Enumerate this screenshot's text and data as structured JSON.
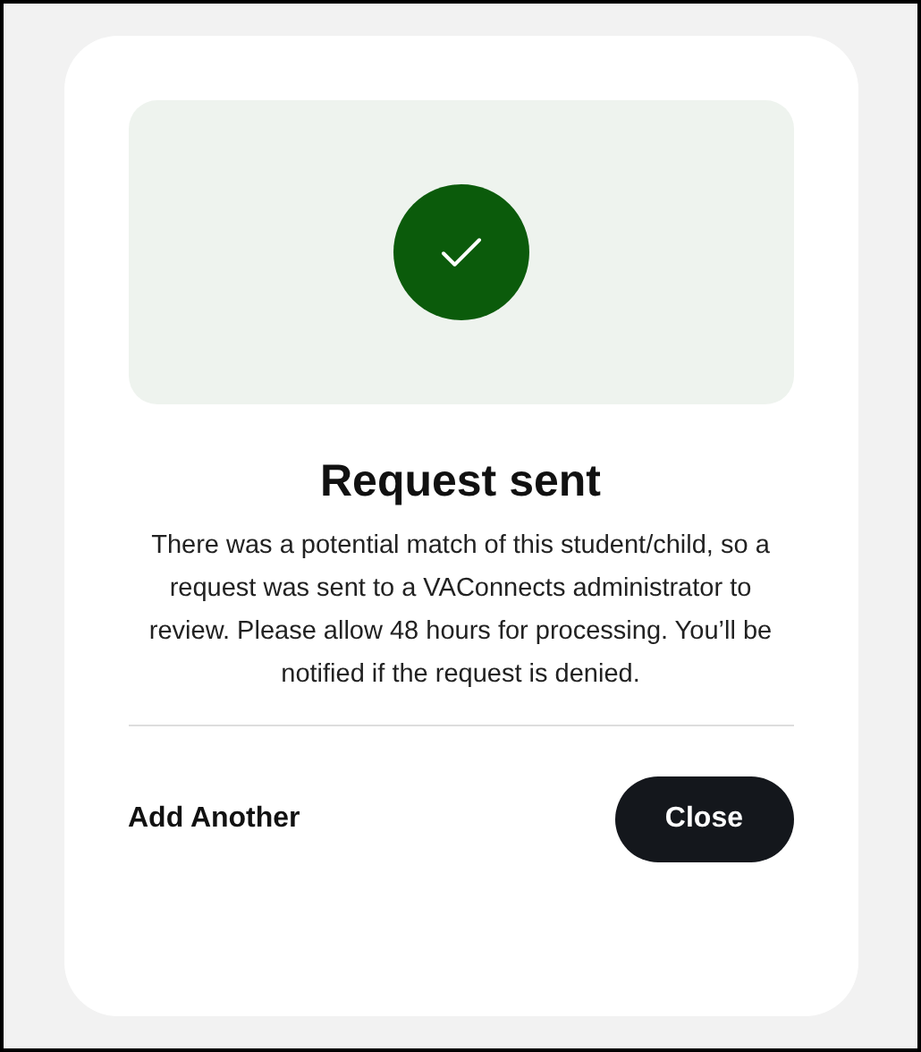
{
  "dialog": {
    "icon": {
      "kind": "check"
    },
    "title": "Request sent",
    "message": "There was a potential match of this student/child, so a request was sent to a VAConnects administrator to review. Please allow 48 hours for processing. You’ll be notified if the request is denied.",
    "buttons": [
      {
        "label": "Add Another",
        "kind": "text"
      },
      {
        "label": "Close",
        "kind": "primary"
      }
    ]
  }
}
